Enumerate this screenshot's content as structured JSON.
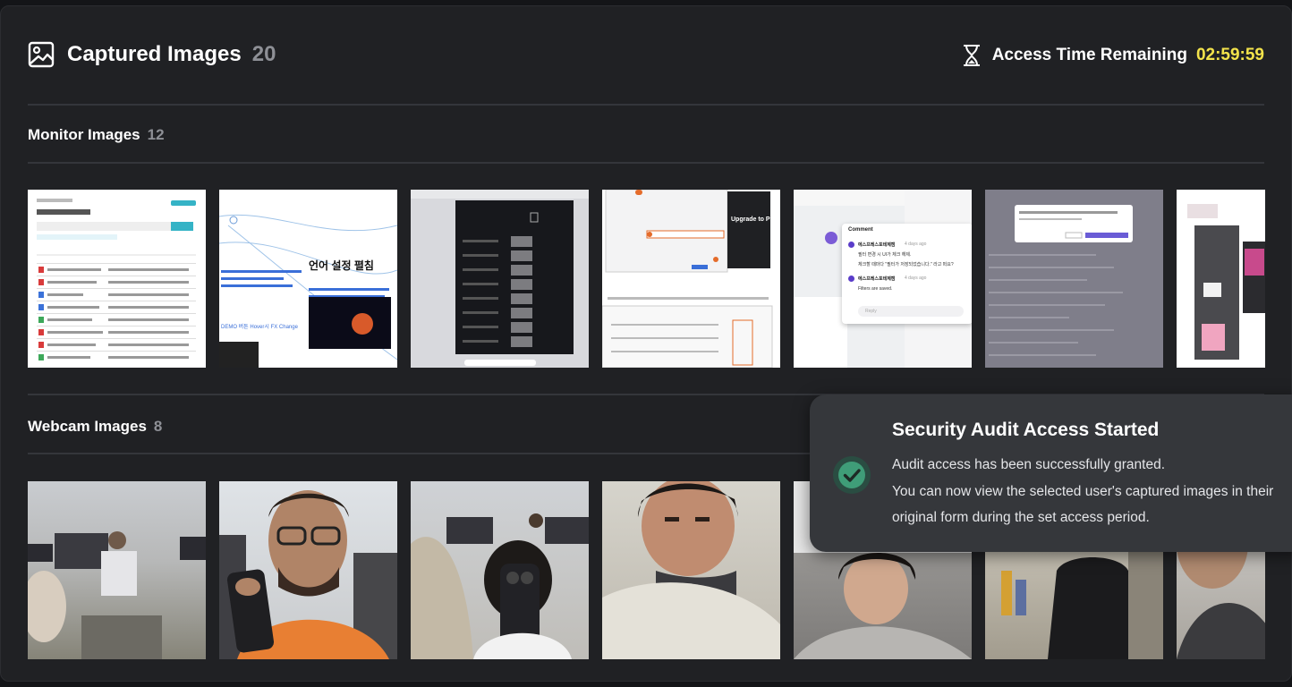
{
  "header": {
    "title": "Captured Images",
    "count": "20",
    "timer_label": "Access Time Remaining",
    "timer_value": "02:59:59"
  },
  "sections": {
    "monitor": {
      "title": "Monitor Images",
      "count": "12"
    },
    "webcam": {
      "title": "Webcam Images",
      "count": "8"
    }
  },
  "monitor_thumbs": {
    "t2_heading": "언어 설정 펼침",
    "t2_link": "DEMO 버튼 Hover시 FX Change",
    "t4_upgrade": "Upgrade to Pro",
    "t5_comment_title": "Comment",
    "t5_user": "에스프레스포테제캠",
    "t5_time": "4 days ago",
    "t5_line1": "필터 변경 시 UI가 체크 해제.",
    "t5_line2": "체크할 때마다 \"필터가 저장되었습니다.\" 라고 떠요?",
    "t5_line3": "Filters are saved.",
    "t5_reply": "Reply"
  },
  "toast": {
    "title": "Security Audit Access Started",
    "line1": "Audit access has been successfully granted.",
    "line2": "You can now view the selected user's captured images in their",
    "line3": "original form during the set access period."
  },
  "colors": {
    "background": "#202124",
    "accent_timer": "#f3e34b",
    "success": "#3f9d78",
    "toast_bg": "#35373b"
  }
}
